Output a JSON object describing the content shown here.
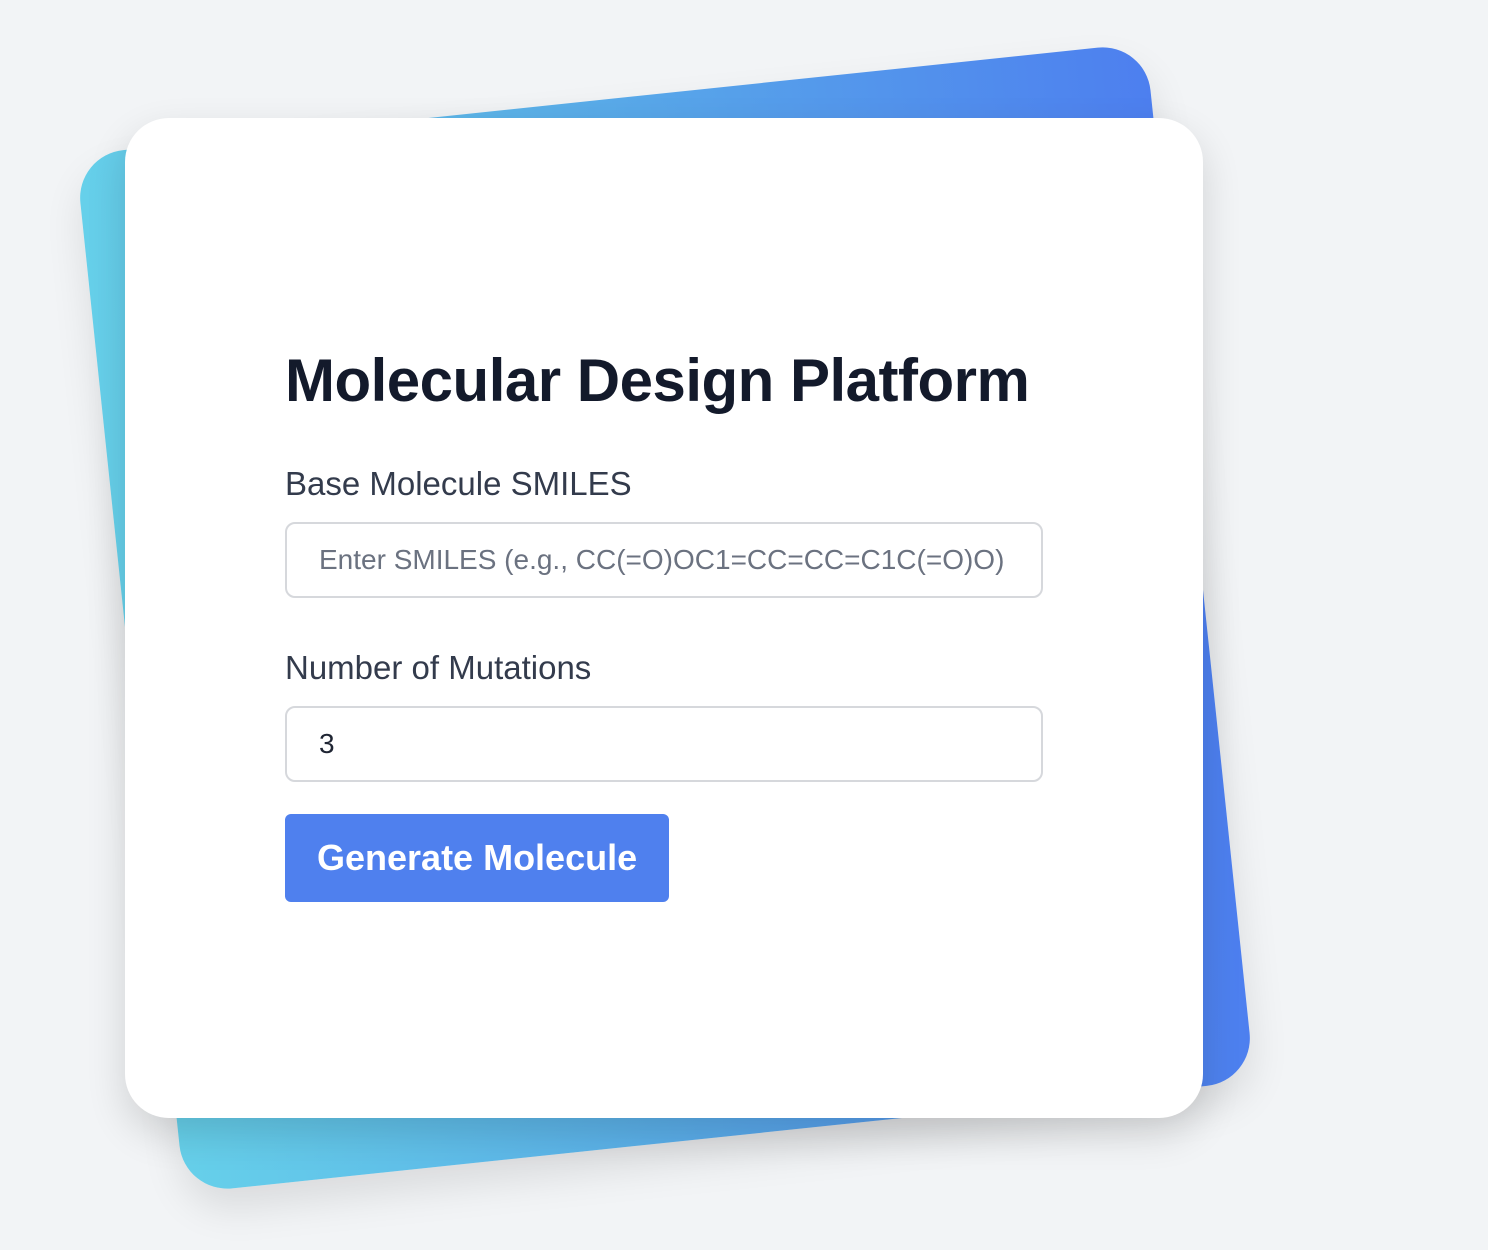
{
  "page": {
    "title": "Molecular Design Platform"
  },
  "form": {
    "smiles": {
      "label": "Base Molecule SMILES",
      "placeholder": "Enter SMILES (e.g., CC(=O)OC1=CC=CC=C1C(=O)O)",
      "value": ""
    },
    "mutations": {
      "label": "Number of Mutations",
      "value": "3"
    },
    "submit_label": "Generate Molecule"
  },
  "colors": {
    "accent": "#4f80ee",
    "title": "#131a2b",
    "label": "#333b4c",
    "gradient_start": "#66d0ea",
    "gradient_end": "#4d7fef",
    "background": "#f2f4f6"
  }
}
